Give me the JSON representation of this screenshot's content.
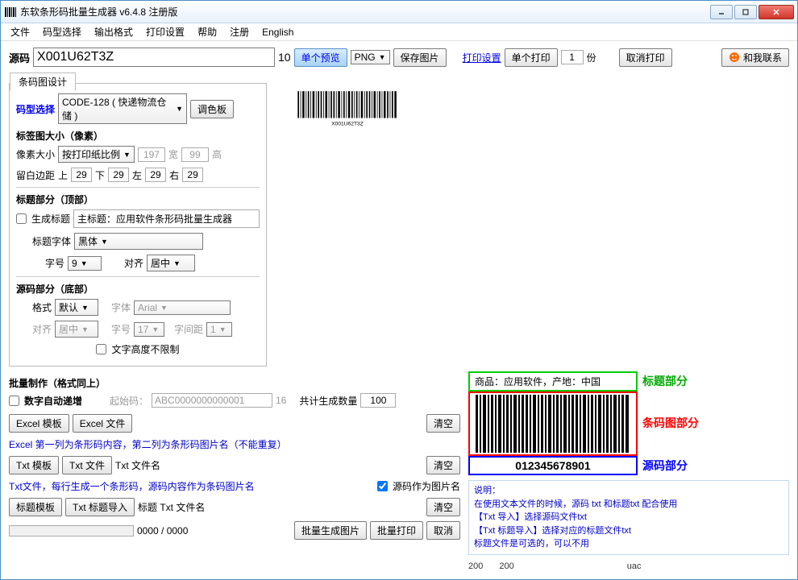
{
  "window": {
    "title": "东软条形码批量生成器 v6.4.8 注册版"
  },
  "menu": {
    "file": "文件",
    "codesel": "码型选择",
    "outfmt": "输出格式",
    "printset": "打印设置",
    "help": "帮助",
    "register": "注册",
    "english": "English"
  },
  "toolbar": {
    "src_label": "源码",
    "src_value": "X001U62T3Z",
    "count": "10",
    "preview_btn": "单个预览",
    "format": "PNG",
    "save_btn": "保存图片",
    "printset_link": "打印设置",
    "singleprint_btn": "单个打印",
    "copies": "1",
    "copies_unit": "份",
    "cancel_print": "取消打印",
    "contact_btn": "和我联系"
  },
  "design": {
    "tab": "条码图设计",
    "codesel_label": "码型选择",
    "code_type": "CODE-128 ( 快递物流仓储     )",
    "palette_btn": "调色板",
    "size_title": "标签图大小（像素）",
    "pxsize_label": "像素大小",
    "pxsize_mode": "按打印纸比例",
    "width": "197",
    "width_lbl": "宽",
    "height": "99",
    "height_lbl": "高",
    "margin_label": "留白边距",
    "margin_top_lbl": "上",
    "margin_top": "29",
    "margin_bottom_lbl": "下",
    "margin_bottom": "29",
    "margin_left_lbl": "左",
    "margin_left": "29",
    "margin_right_lbl": "右",
    "margin_right": "29",
    "title_section": "标题部分（顶部）",
    "gen_title_chk": "生成标题",
    "main_title_lbl": "主标题：",
    "main_title_val": "应用软件条形码批量生成器",
    "title_font_lbl": "标题字体",
    "title_font": "黑体",
    "fontsize_lbl": "字号",
    "fontsize": "9",
    "align_lbl": "对齐",
    "align": "居中",
    "src_section": "源码部分（底部）",
    "fmt_lbl": "格式",
    "fmt": "默认",
    "src_font_lbl": "字体",
    "src_font": "Arial",
    "src_align_lbl": "对齐",
    "src_align": "居中",
    "src_fontsize_lbl": "字号",
    "src_fontsize": "17",
    "letterspace_lbl": "字间距",
    "letterspace": "1",
    "noheight_chk": "文字高度不限制"
  },
  "batch": {
    "title": "批量制作（格式同上）",
    "auto_inc_chk": "数字自动递增",
    "start_lbl": "起始码：",
    "start_val": "ABC0000000000001",
    "start_len": "16",
    "total_lbl": "共计生成数量",
    "total": "100",
    "excel_tmpl": "Excel 模板",
    "excel_file": "Excel 文件",
    "clear": "清空",
    "excel_hint": "Excel 第一列为条形码内容，第二列为条形码图片名（不能重复）",
    "txt_tmpl": "Txt 模板",
    "txt_file": "Txt 文件",
    "txt_name_lbl": "Txt 文件名",
    "txt_hint": "Txt文件，每行生成一个条形码，源码内容作为条码图片名",
    "src_as_name_chk": "源码作为图片名",
    "title_tmpl": "标题模板",
    "title_import": "Txt 标题导入",
    "title_txt_lbl": "标题 Txt 文件名",
    "progress": "0000 / 0000",
    "batch_gen": "批量生成图片",
    "batch_print": "批量打印",
    "cancel": "取消"
  },
  "legend": {
    "product": "商品：应用软件，产地：中国",
    "title_part": "标题部分",
    "barcode_part": "条码图部分",
    "src_part": "源码部分",
    "code_txt": "012345678901"
  },
  "help": {
    "hdr": "说明：",
    "line1": "在使用文本文件的时候，源码 txt 和标题txt 配合使用",
    "line2": "【Txt 导入】选择源码文件txt",
    "line3": "【Txt 标题导入】选择对应的标题文件txt",
    "line4": "标题文件是可选的，可以不用"
  },
  "footer": {
    "n1": "200",
    "n2": "200",
    "n3": "uac"
  }
}
